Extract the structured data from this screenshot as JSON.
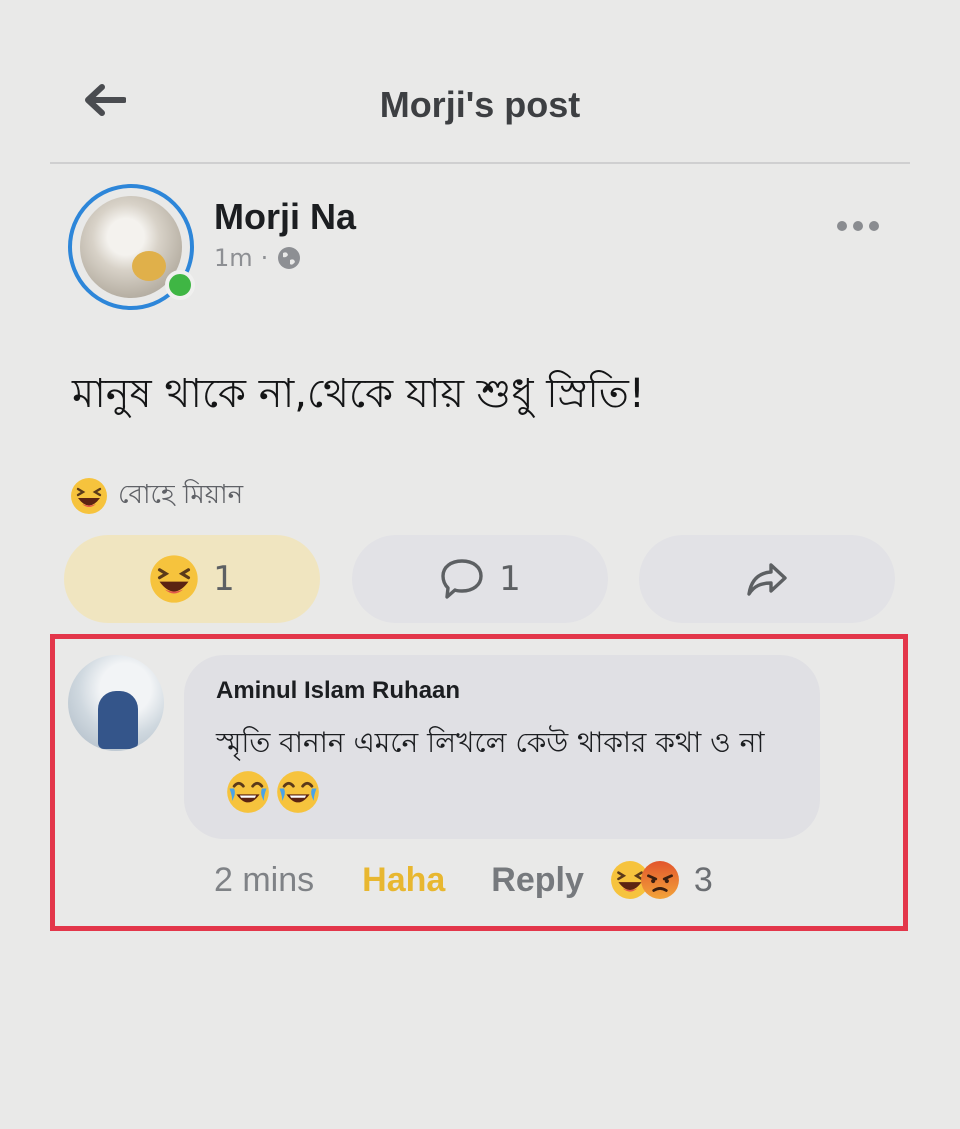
{
  "header": {
    "title": "Morji's post",
    "back_icon": "arrow-left-icon"
  },
  "post": {
    "author": "Morji Na",
    "time": "1m",
    "separator": "·",
    "privacy_icon": "globe-icon",
    "text": "মানুষ থাকে না,থেকে যায় শুধু স্রিতি!",
    "reactor_name": "বোহে মিয়ান",
    "reaction_count": "1",
    "comment_count": "1",
    "online_color": "#3fb644",
    "ring_color": "#2d86d9"
  },
  "comment": {
    "author": "Aminul Islam Ruhaan",
    "text": "স্মৃতি বানান এমনে লিখলে কেউ থাকার কথা ও না",
    "time": "2 mins",
    "reaction_label": "Haha",
    "reply_label": "Reply",
    "reaction_count": "3",
    "highlight_color": "#e3364a"
  }
}
